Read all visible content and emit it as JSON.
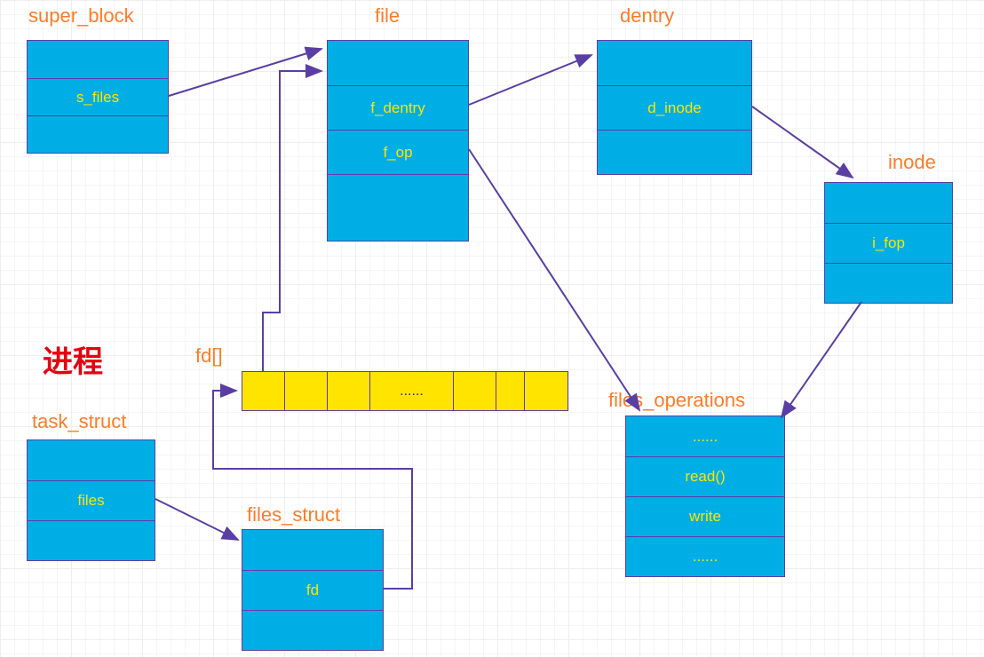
{
  "labels": {
    "super_block": "super_block",
    "file": "file",
    "dentry": "dentry",
    "inode": "inode",
    "fd_array": "fd[]",
    "task_struct": "task_struct",
    "files_struct": "files_struct",
    "files_operations": "files_operations",
    "process": "进程"
  },
  "boxes": {
    "super_block": {
      "rows": [
        "",
        "s_files",
        ""
      ]
    },
    "file": {
      "rows": [
        "",
        "f_dentry",
        "f_op",
        ""
      ]
    },
    "dentry": {
      "rows": [
        "",
        "d_inode",
        ""
      ]
    },
    "inode": {
      "rows": [
        "",
        "i_fop",
        ""
      ]
    },
    "task_struct": {
      "rows": [
        "",
        "files",
        ""
      ]
    },
    "files_struct": {
      "rows": [
        "",
        "fd",
        ""
      ]
    },
    "files_operations": {
      "rows": [
        "......",
        "read()",
        "write",
        "......"
      ]
    }
  },
  "fd_array": {
    "cells": [
      "",
      "",
      "",
      "......",
      "",
      "",
      ""
    ]
  },
  "diagram_meta": {
    "description": "Linux VFS data structure relationships diagram",
    "arrows": [
      {
        "from": "super_block.s_files",
        "to": "file"
      },
      {
        "from": "file.f_dentry",
        "to": "dentry"
      },
      {
        "from": "dentry.d_inode",
        "to": "inode"
      },
      {
        "from": "file.f_op",
        "to": "files_operations"
      },
      {
        "from": "inode.i_fop",
        "to": "files_operations"
      },
      {
        "from": "task_struct.files",
        "to": "files_struct"
      },
      {
        "from": "files_struct.fd",
        "to": "fd[]"
      },
      {
        "from": "fd[]",
        "to": "file"
      }
    ]
  }
}
